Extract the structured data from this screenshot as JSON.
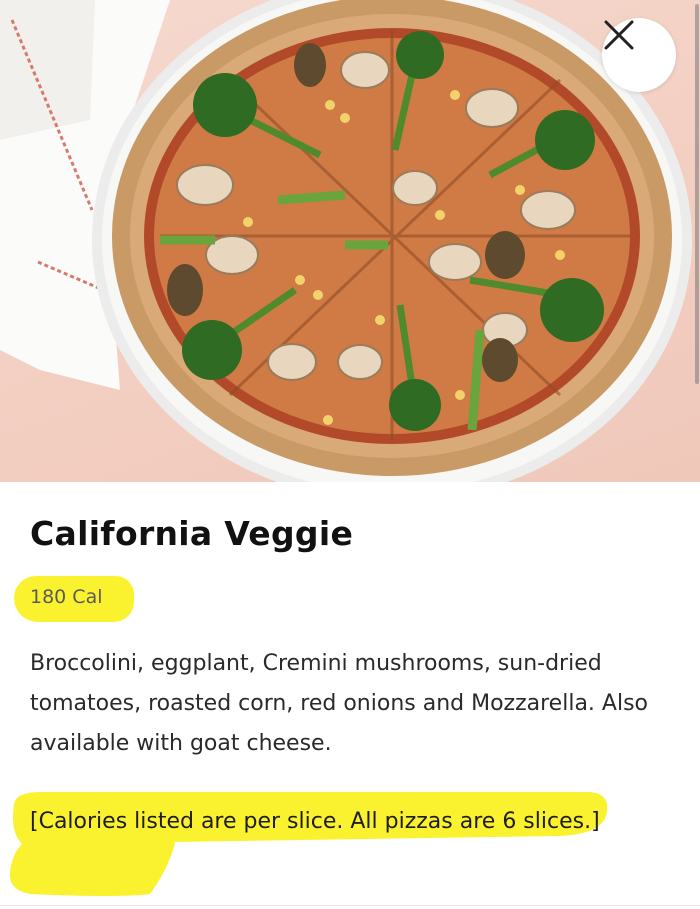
{
  "hero": {
    "image_icon": "pizza-photo-icon",
    "close_icon": "close-icon"
  },
  "item": {
    "title": "California Veggie",
    "calories": "180 Cal",
    "description": "Broccolini, eggplant, Cremini mushrooms, sun-dried tomatoes, roasted corn, red onions and Mozzarella. Also available with goat cheese.",
    "note": "[Calories listed are per slice. All pizzas are 6 slices.]"
  },
  "colors": {
    "highlight": "#fbf22f",
    "background_pink": "#f3cfc2",
    "text": "#111111"
  }
}
